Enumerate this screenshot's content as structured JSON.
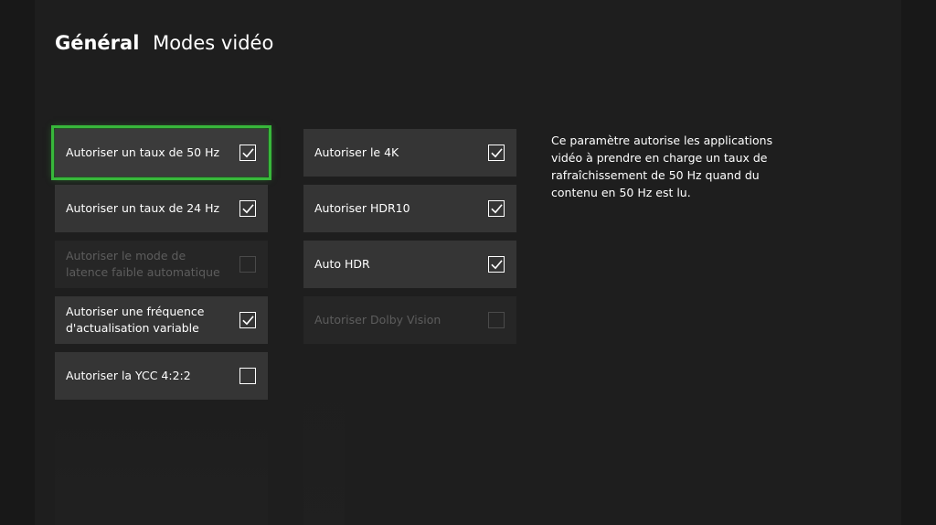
{
  "header": {
    "section": "Général",
    "page": "Modes vidéo"
  },
  "left_column": [
    {
      "label": "Autoriser un taux de 50 Hz",
      "checked": true,
      "enabled": true,
      "focused": true
    },
    {
      "label": "Autoriser un taux de 24 Hz",
      "checked": true,
      "enabled": true,
      "focused": false
    },
    {
      "label": "Autoriser le mode de latence faible automatique",
      "checked": false,
      "enabled": false,
      "focused": false
    },
    {
      "label": "Autoriser une fréquence d'actualisation variable",
      "checked": true,
      "enabled": true,
      "focused": false
    },
    {
      "label": "Autoriser la YCC 4:2:2",
      "checked": false,
      "enabled": true,
      "focused": false
    }
  ],
  "right_column": [
    {
      "label": "Autoriser le 4K",
      "checked": true,
      "enabled": true,
      "focused": false
    },
    {
      "label": "Autoriser HDR10",
      "checked": true,
      "enabled": true,
      "focused": false
    },
    {
      "label": "Auto HDR",
      "checked": true,
      "enabled": true,
      "focused": false
    },
    {
      "label": "Autoriser Dolby Vision",
      "checked": false,
      "enabled": false,
      "focused": false
    }
  ],
  "description": "Ce paramètre autorise les applications vidéo à prendre en charge un taux de rafraîchissement de 50 Hz quand du contenu en 50 Hz est lu.",
  "colors": {
    "background": "#1e1e1e",
    "tile": "#353535",
    "tile_disabled": "#262626",
    "focus": "#38b83b"
  },
  "icons": {
    "checked": "checkbox-checked-icon",
    "unchecked": "checkbox-unchecked-icon"
  }
}
